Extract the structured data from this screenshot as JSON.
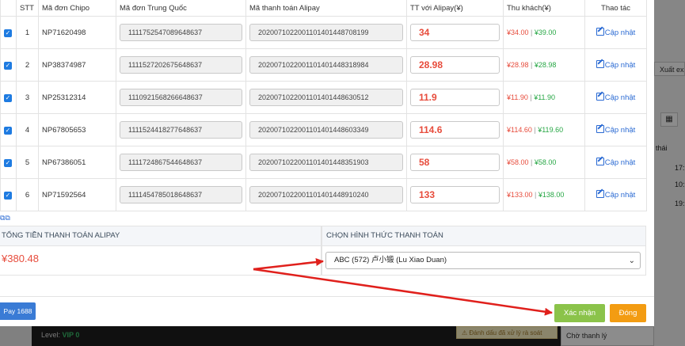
{
  "table": {
    "headers": [
      "",
      "STT",
      "Mã đơn Chipo",
      "Mã đơn Trung Quốc",
      "Mã thanh toán Alipay",
      "TT với Alipay(¥)",
      "Thu khách(¥)",
      "Thao tác"
    ],
    "rows": [
      {
        "stt": "1",
        "chipo": "NP71620498",
        "cn": "1111752547089648637",
        "alipay": "2020071022001101401448708199",
        "amount": "34",
        "charged": "¥34.00",
        "collected": "¥39.00",
        "action": "Cập nhật"
      },
      {
        "stt": "2",
        "chipo": "NP38374987",
        "cn": "1111527202675648637",
        "alipay": "2020071022001101401448318984",
        "amount": "28.98",
        "charged": "¥28.98",
        "collected": "¥28.98",
        "action": "Cập nhật"
      },
      {
        "stt": "3",
        "chipo": "NP25312314",
        "cn": "1110921568266648637",
        "alipay": "2020071022001101401448630512",
        "amount": "11.9",
        "charged": "¥11.90",
        "collected": "¥11.90",
        "action": "Cập nhật"
      },
      {
        "stt": "4",
        "chipo": "NP67805653",
        "cn": "1111524418277648637",
        "alipay": "2020071022001101401448603349",
        "amount": "114.6",
        "charged": "¥114.60",
        "collected": "¥119.60",
        "action": "Cập nhật"
      },
      {
        "stt": "5",
        "chipo": "NP67386051",
        "cn": "1111724867544648637",
        "alipay": "2020071022001101401448351903",
        "amount": "58",
        "charged": "¥58.00",
        "collected": "¥58.00",
        "action": "Cập nhật"
      },
      {
        "stt": "6",
        "chipo": "NP71592564",
        "cn": "1111454785018648637",
        "alipay": "2020071022001101401448910240",
        "amount": "133",
        "charged": "¥133.00",
        "collected": "¥138.00",
        "action": "Cập nhật"
      }
    ]
  },
  "total": {
    "label": "TỔNG TIỀN THANH TOÁN ALIPAY",
    "value": "¥380.48"
  },
  "payment": {
    "label": "CHỌN HÌNH THỨC THANH TOÁN",
    "selected": "ABC (572) 卢小锻 (Lu Xiao Duan)"
  },
  "buttons": {
    "pay": "Pay 1688",
    "confirm": "Xác nhận",
    "close": "Đóng"
  },
  "background": {
    "export": "Xuất ex",
    "status_col": "thái",
    "times": [
      "17:",
      "10:",
      "19:"
    ],
    "level_label": "Level:",
    "level_value": "VIP 0",
    "warning": "Đánh dấu đã xử lý rà soát",
    "waiting": "Chờ thanh lý"
  },
  "colors": {
    "red": "#e74c3c",
    "green": "#27a745",
    "link": "#2a6ad3",
    "confirm": "#8bc34a",
    "close": "#f39c12",
    "pay": "#3a7bd5"
  }
}
